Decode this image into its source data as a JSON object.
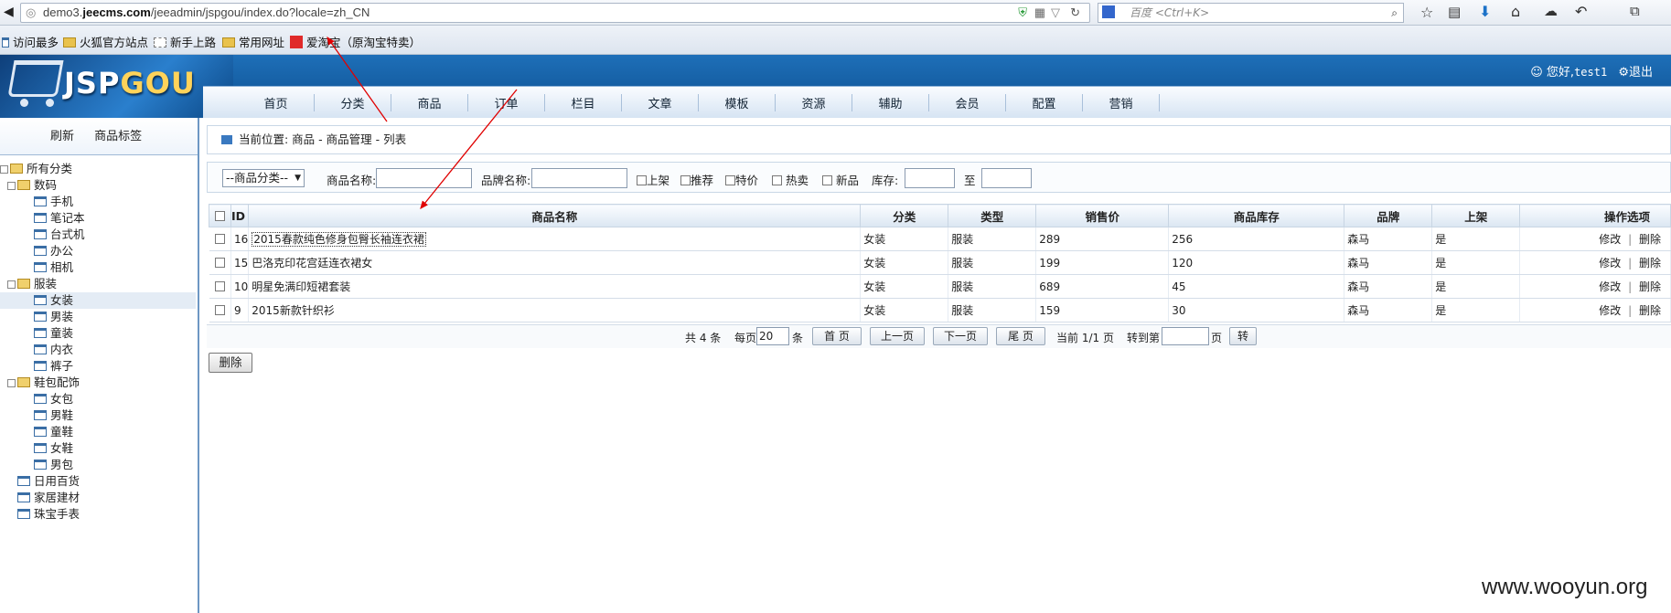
{
  "browser": {
    "url_pre": "demo3.",
    "url_domain": "jeecms.com",
    "url_post": "/jeeadmin/jspgou/index.do?locale=zh_CN",
    "search_placeholder": "百度 <Ctrl+K>"
  },
  "bookmarks": [
    "访问最多",
    "火狐官方站点",
    "新手上路",
    "常用网址",
    "爱淘宝（原淘宝特卖）"
  ],
  "app": {
    "logo_a": "JSP",
    "logo_b": "GOU",
    "user_greeting": "您好,",
    "username": "test1",
    "logout": "退出"
  },
  "nav": [
    "首页",
    "分类",
    "商品",
    "订单",
    "栏目",
    "文章",
    "模板",
    "资源",
    "辅助",
    "会员",
    "配置",
    "营销"
  ],
  "sidebar": {
    "tabs": [
      "刷新",
      "商品标签"
    ],
    "tree": [
      {
        "label": "所有分类"
      },
      {
        "label": "数码"
      },
      {
        "label": "手机"
      },
      {
        "label": "笔记本"
      },
      {
        "label": "台式机"
      },
      {
        "label": "办公"
      },
      {
        "label": "相机"
      },
      {
        "label": "服装"
      },
      {
        "label": "女装"
      },
      {
        "label": "男装"
      },
      {
        "label": "童装"
      },
      {
        "label": "内衣"
      },
      {
        "label": "裤子"
      },
      {
        "label": "鞋包配饰"
      },
      {
        "label": "女包"
      },
      {
        "label": "男鞋"
      },
      {
        "label": "童鞋"
      },
      {
        "label": "女鞋"
      },
      {
        "label": "男包"
      },
      {
        "label": "日用百货"
      },
      {
        "label": "家居建材"
      },
      {
        "label": "珠宝手表"
      }
    ]
  },
  "breadcrumb": "当前位置: 商品 - 商品管理 - 列表",
  "filters": {
    "category": "--商品分类--",
    "name_label": "商品名称:",
    "brand_label": "品牌名称:",
    "onsale": "上架",
    "recommend": "推荐",
    "special": "特价",
    "hot": "热卖",
    "new": "新品",
    "stock_label": "库存:",
    "to_label": "至"
  },
  "table": {
    "headers": [
      "ID",
      "商品名称",
      "分类",
      "类型",
      "销售价",
      "商品库存",
      "品牌",
      "上架",
      "操作选项"
    ],
    "rows": [
      {
        "id": "16",
        "name": "2015春款纯色修身包臀长袖连衣裙",
        "category": "女装",
        "type": "服装",
        "price": "289",
        "stock": "256",
        "brand": "森马",
        "onsale": "是"
      },
      {
        "id": "15",
        "name": "巴洛克印花宫廷连衣裙女",
        "category": "女装",
        "type": "服装",
        "price": "199",
        "stock": "120",
        "brand": "森马",
        "onsale": "是"
      },
      {
        "id": "10",
        "name": "明星免满印短裙套装",
        "category": "女装",
        "type": "服装",
        "price": "689",
        "stock": "45",
        "brand": "森马",
        "onsale": "是"
      },
      {
        "id": "9",
        "name": "2015新款针织衫",
        "category": "女装",
        "type": "服装",
        "price": "159",
        "stock": "30",
        "brand": "森马",
        "onsale": "是"
      }
    ],
    "edit": "修改",
    "sep": "|",
    "delete": "删除"
  },
  "pager": {
    "total": "共 4 条",
    "per_page_label": "每页",
    "per_page": "20",
    "per_page_unit": "条",
    "first": "首 页",
    "prev": "上一页",
    "next": "下一页",
    "last": "尾 页",
    "current": "当前 1/1 页",
    "goto_label": "转到第",
    "goto_unit": "页",
    "go": "转"
  },
  "delete_button": "删除",
  "watermark": "www.wooyun.org",
  "colors": {
    "header_blue": "#1e6fb8",
    "annotation_red": "#e00000"
  }
}
